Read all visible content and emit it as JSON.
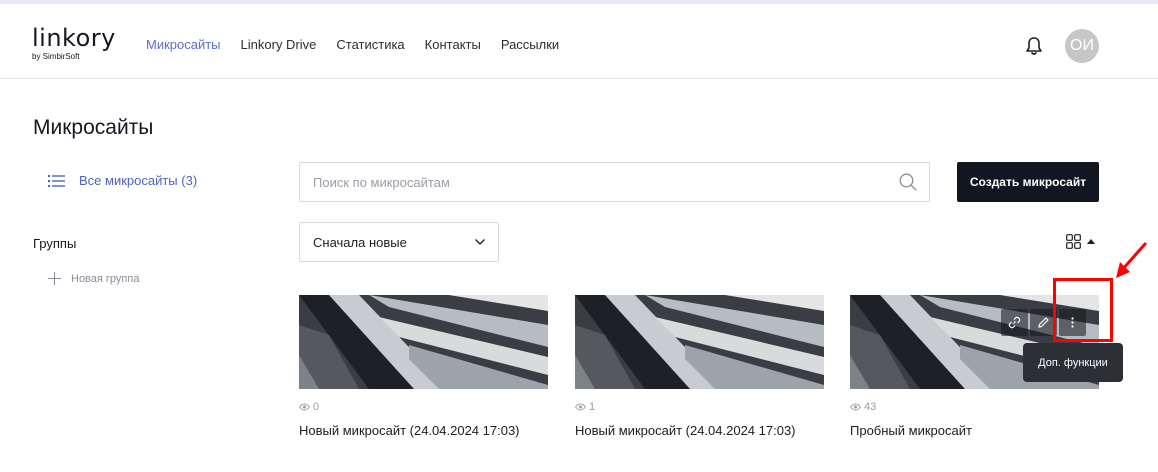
{
  "header": {
    "logo_main": "linkory",
    "logo_sub": "by SimbirSoft",
    "nav": [
      "Микросайты",
      "Linkory Drive",
      "Статистика",
      "Контакты",
      "Рассылки"
    ],
    "avatar_initials": "ОИ"
  },
  "page": {
    "title": "Микросайты"
  },
  "sidebar": {
    "all_sites_label": "Все микросайты (3)",
    "groups_title": "Группы",
    "new_group_label": "Новая группа"
  },
  "toolbar": {
    "search_placeholder": "Поиск по микросайтам",
    "create_label": "Создать микросайт",
    "sort_label": "Сначала новые"
  },
  "cards": [
    {
      "views": "0",
      "title": "Новый микросайт (24.04.2024 17:03)"
    },
    {
      "views": "1",
      "title": "Новый микросайт (24.04.2024 17:03)"
    },
    {
      "views": "43",
      "title": "Пробный микросайт"
    }
  ],
  "tooltip": {
    "text": "Доп. функции"
  },
  "colors": {
    "accent": "#5a6fc9",
    "primary_button": "#111721",
    "highlight": "#ff0000"
  }
}
